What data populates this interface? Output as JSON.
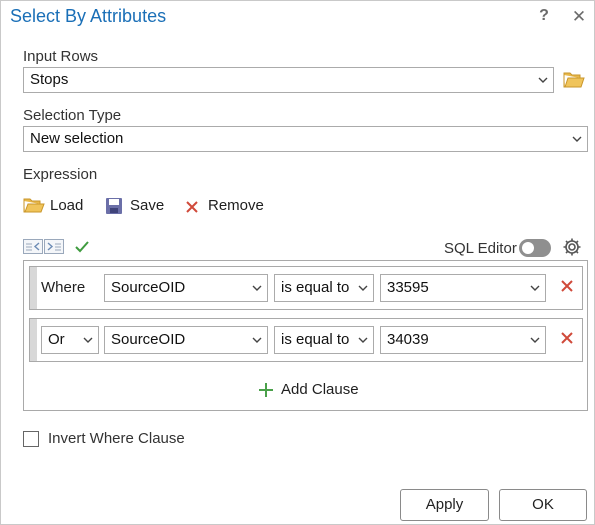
{
  "window": {
    "title": "Select By Attributes",
    "help_glyph": "?",
    "close_glyph": "✕"
  },
  "input_rows": {
    "label": "Input Rows",
    "value": "Stops"
  },
  "selection_type": {
    "label": "Selection Type",
    "value": "New selection"
  },
  "expression": {
    "label": "Expression",
    "load_label": "Load",
    "save_label": "Save",
    "remove_label": "Remove",
    "sql_editor_label": "SQL Editor",
    "sql_editor_on": false
  },
  "clauses": [
    {
      "connector": "Where",
      "field": "SourceOID",
      "operator": "is equal to",
      "value": "33595"
    },
    {
      "connector": "Or",
      "field": "SourceOID",
      "operator": "is equal to",
      "value": "34039"
    }
  ],
  "add_clause_label": "Add Clause",
  "invert_where_clause": {
    "label": "Invert Where Clause",
    "checked": false
  },
  "buttons": {
    "apply": "Apply",
    "ok": "OK"
  },
  "colors": {
    "title": "#1a6fb7",
    "folder": "#e8b84a",
    "remove": "#d04a3a",
    "check": "#3f9b3f",
    "add": "#4aa04a",
    "save_icon": "#6b6fa8"
  },
  "icons": {
    "folder": "folder-icon",
    "save": "floppy-disk-icon",
    "remove": "red-x-icon",
    "check": "checkmark-icon",
    "settings": "gear-icon",
    "add": "plus-icon"
  }
}
